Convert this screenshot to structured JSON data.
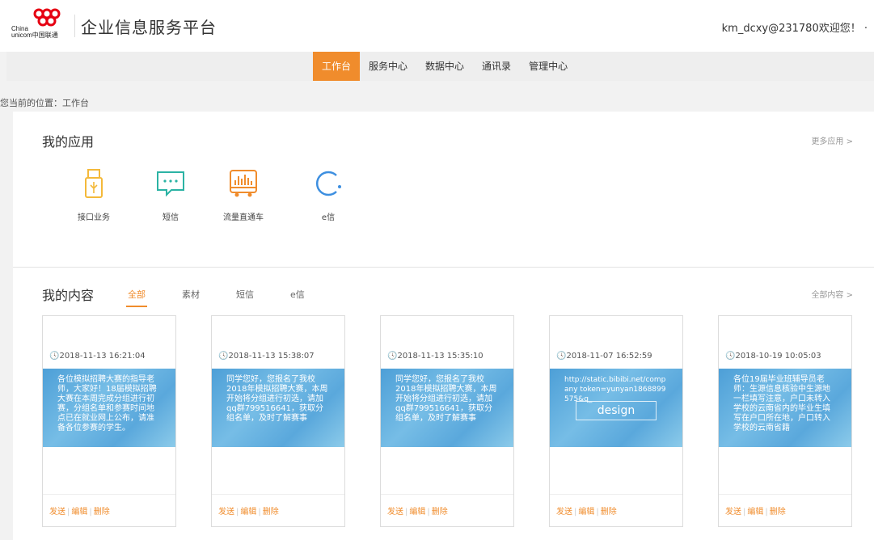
{
  "header": {
    "logo_text_en_1": "China",
    "logo_text_en_2": "unicom中国联通",
    "title": "企业信息服务平台",
    "user": "km_dcxy@231780欢迎您！ ·"
  },
  "nav": {
    "items": [
      "工作台",
      "服务中心",
      "数据中心",
      "通讯录",
      "管理中心"
    ],
    "active_index": 0
  },
  "breadcrumb": "您当前的位置：工作台",
  "apps": {
    "title": "我的应用",
    "more": "更多应用 >",
    "items": [
      {
        "label": "接口业务",
        "icon": "usb-icon",
        "color": "#f4b93a"
      },
      {
        "label": "短信",
        "icon": "message-icon",
        "color": "#2bb3a4"
      },
      {
        "label": "流量直通车",
        "icon": "bus-icon",
        "color": "#f08c2c"
      },
      {
        "label": "e信",
        "icon": "e-icon",
        "color": "#3d8fe0"
      }
    ]
  },
  "content": {
    "title": "我的内容",
    "more": "全部内容 >",
    "tabs": [
      "全部",
      "素材",
      "短信",
      "e信"
    ],
    "active_tab": 0,
    "cards": [
      {
        "date": "2018-11-13 16:21:04",
        "text": "各位模拟招聘大赛的指导老师，大家好！18届模拟招聘大赛在本周完成分组进行初赛，分组名单和参赛时间地点已在就业网上公布，请准备各位参赛的学生。",
        "design": ""
      },
      {
        "date": "2018-11-13 15:38:07",
        "text": "同学您好，您报名了我校2018年模拟招聘大赛，本周开始将分组进行初选，请加qq群799516641，获取分组名单，及时了解赛事",
        "design": ""
      },
      {
        "date": "2018-11-13 15:35:10",
        "text": "同学您好，您报名了我校2018年模拟招聘大赛，本周开始将分组进行初选，请加qq群799516641，获取分组名单，及时了解赛事",
        "design": ""
      },
      {
        "date": "2018-11-07 16:52:59",
        "text": "http://static.bibibi.net/company token=yunyan1868899575&q_",
        "design": "design"
      },
      {
        "date": "2018-10-19 10:05:03",
        "text": "各位19届毕业班辅导员老师：生源信息核验中生源地一栏填写注意，户口未转入学校的云南省内的毕业生填写在户口所在地，户口转入学校的云南省籍",
        "design": ""
      }
    ],
    "actions": [
      "发送",
      "编辑",
      "删除"
    ]
  },
  "colors": {
    "accent": "#f08c2c",
    "unicom_red": "#e60012"
  }
}
